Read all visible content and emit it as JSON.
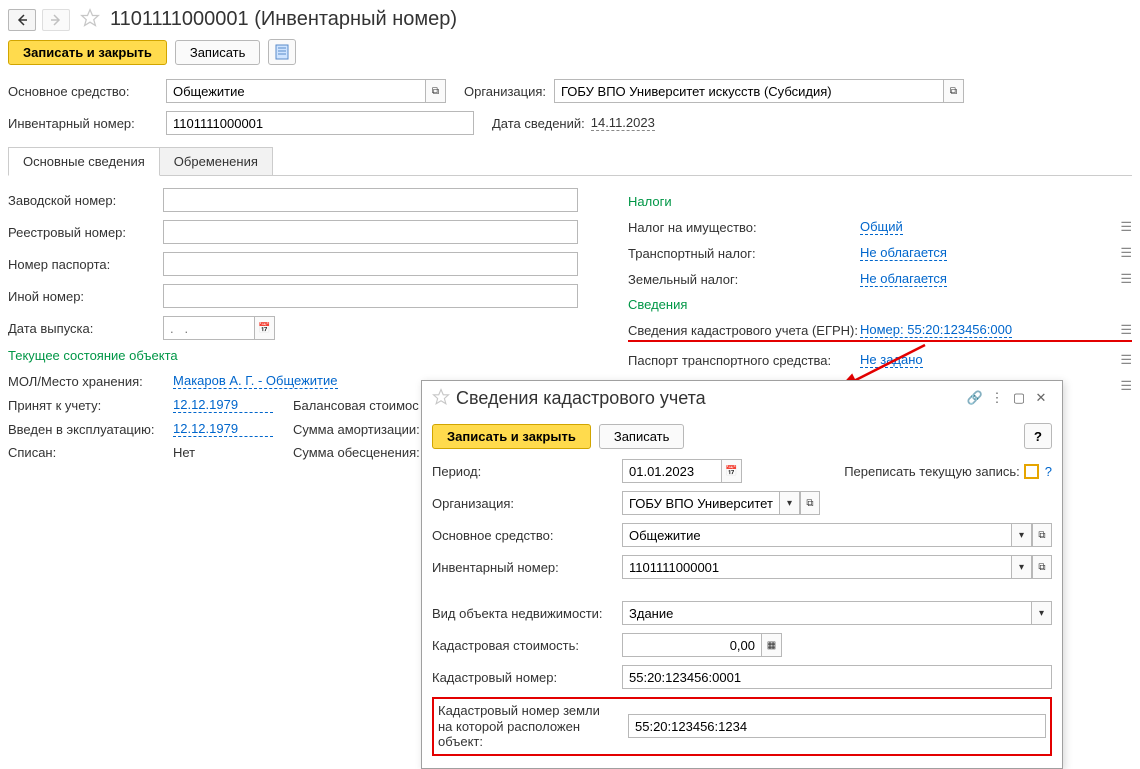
{
  "header": {
    "title": "1101111000001 (Инвентарный номер)"
  },
  "toolbar": {
    "save_close": "Записать и закрыть",
    "save": "Записать"
  },
  "main": {
    "asset_label": "Основное средство:",
    "asset_value": "Общежитие",
    "org_label": "Организация:",
    "org_value": "ГОБУ ВПО Университет искусств (Субсидия)",
    "inv_label": "Инвентарный номер:",
    "inv_value": "1101111000001",
    "date_label": "Дата сведений:",
    "date_value": "14.11.2023"
  },
  "tabs": {
    "tab1": "Основные сведения",
    "tab2": "Обременения"
  },
  "left": {
    "factory_no": "Заводской номер:",
    "registry_no": "Реестровый номер:",
    "passport_no": "Номер паспорта:",
    "other_no": "Иной номер:",
    "release_date": "Дата выпуска:",
    "release_date_ph": ".   .",
    "section_state": "Текущее состояние объекта",
    "mol_label": "МОЛ/Место хранения:",
    "mol_value": "Макаров А. Г. - Общежитие",
    "accepted_label": "Принят к учету:",
    "accepted_value": "12.12.1979",
    "balance_label": "Балансовая стоимос",
    "commissioned_label": "Введен в эксплуатацию:",
    "commissioned_value": "12.12.1979",
    "amort_label": "Сумма амортизации:",
    "written_off_label": "Списан:",
    "written_off_value": "Нет",
    "impair_label": "Сумма обесценения:"
  },
  "right": {
    "taxes_section": "Налоги",
    "property_tax_label": "Налог на имущество:",
    "property_tax_value": "Общий",
    "transport_tax_label": "Транспортный налог:",
    "transport_tax_value": "Не облагается",
    "land_tax_label": "Земельный налог:",
    "land_tax_value": "Не облагается",
    "info_section": "Сведения",
    "cadastre_label": "Сведения кадастрового учета (ЕГРН):",
    "cadastre_value": "Номер: 55:20:123456:000",
    "pts_label": "Паспорт транспортного средства:",
    "pts_value": "Не задано"
  },
  "dialog": {
    "title": "Сведения кадастрового учета",
    "save_close": "Записать и закрыть",
    "save": "Записать",
    "period_label": "Период:",
    "period_value": "01.01.2023",
    "overwrite_label": "Переписать текущую запись:",
    "org_label": "Организация:",
    "org_value": "ГОБУ ВПО Университет и",
    "asset_label": "Основное средство:",
    "asset_value": "Общежитие",
    "inv_label": "Инвентарный номер:",
    "inv_value": "1101111000001",
    "obj_type_label": "Вид объекта недвижимости:",
    "obj_type_value": "Здание",
    "cad_cost_label": "Кадастровая стоимость:",
    "cad_cost_value": "0,00",
    "cad_no_label": "Кадастровый номер:",
    "cad_no_value": "55:20:123456:0001",
    "land_no_label1": "Кадастровый номер земли",
    "land_no_label2": "на которой расположен объект:",
    "land_no_value": "55:20:123456:1234"
  }
}
